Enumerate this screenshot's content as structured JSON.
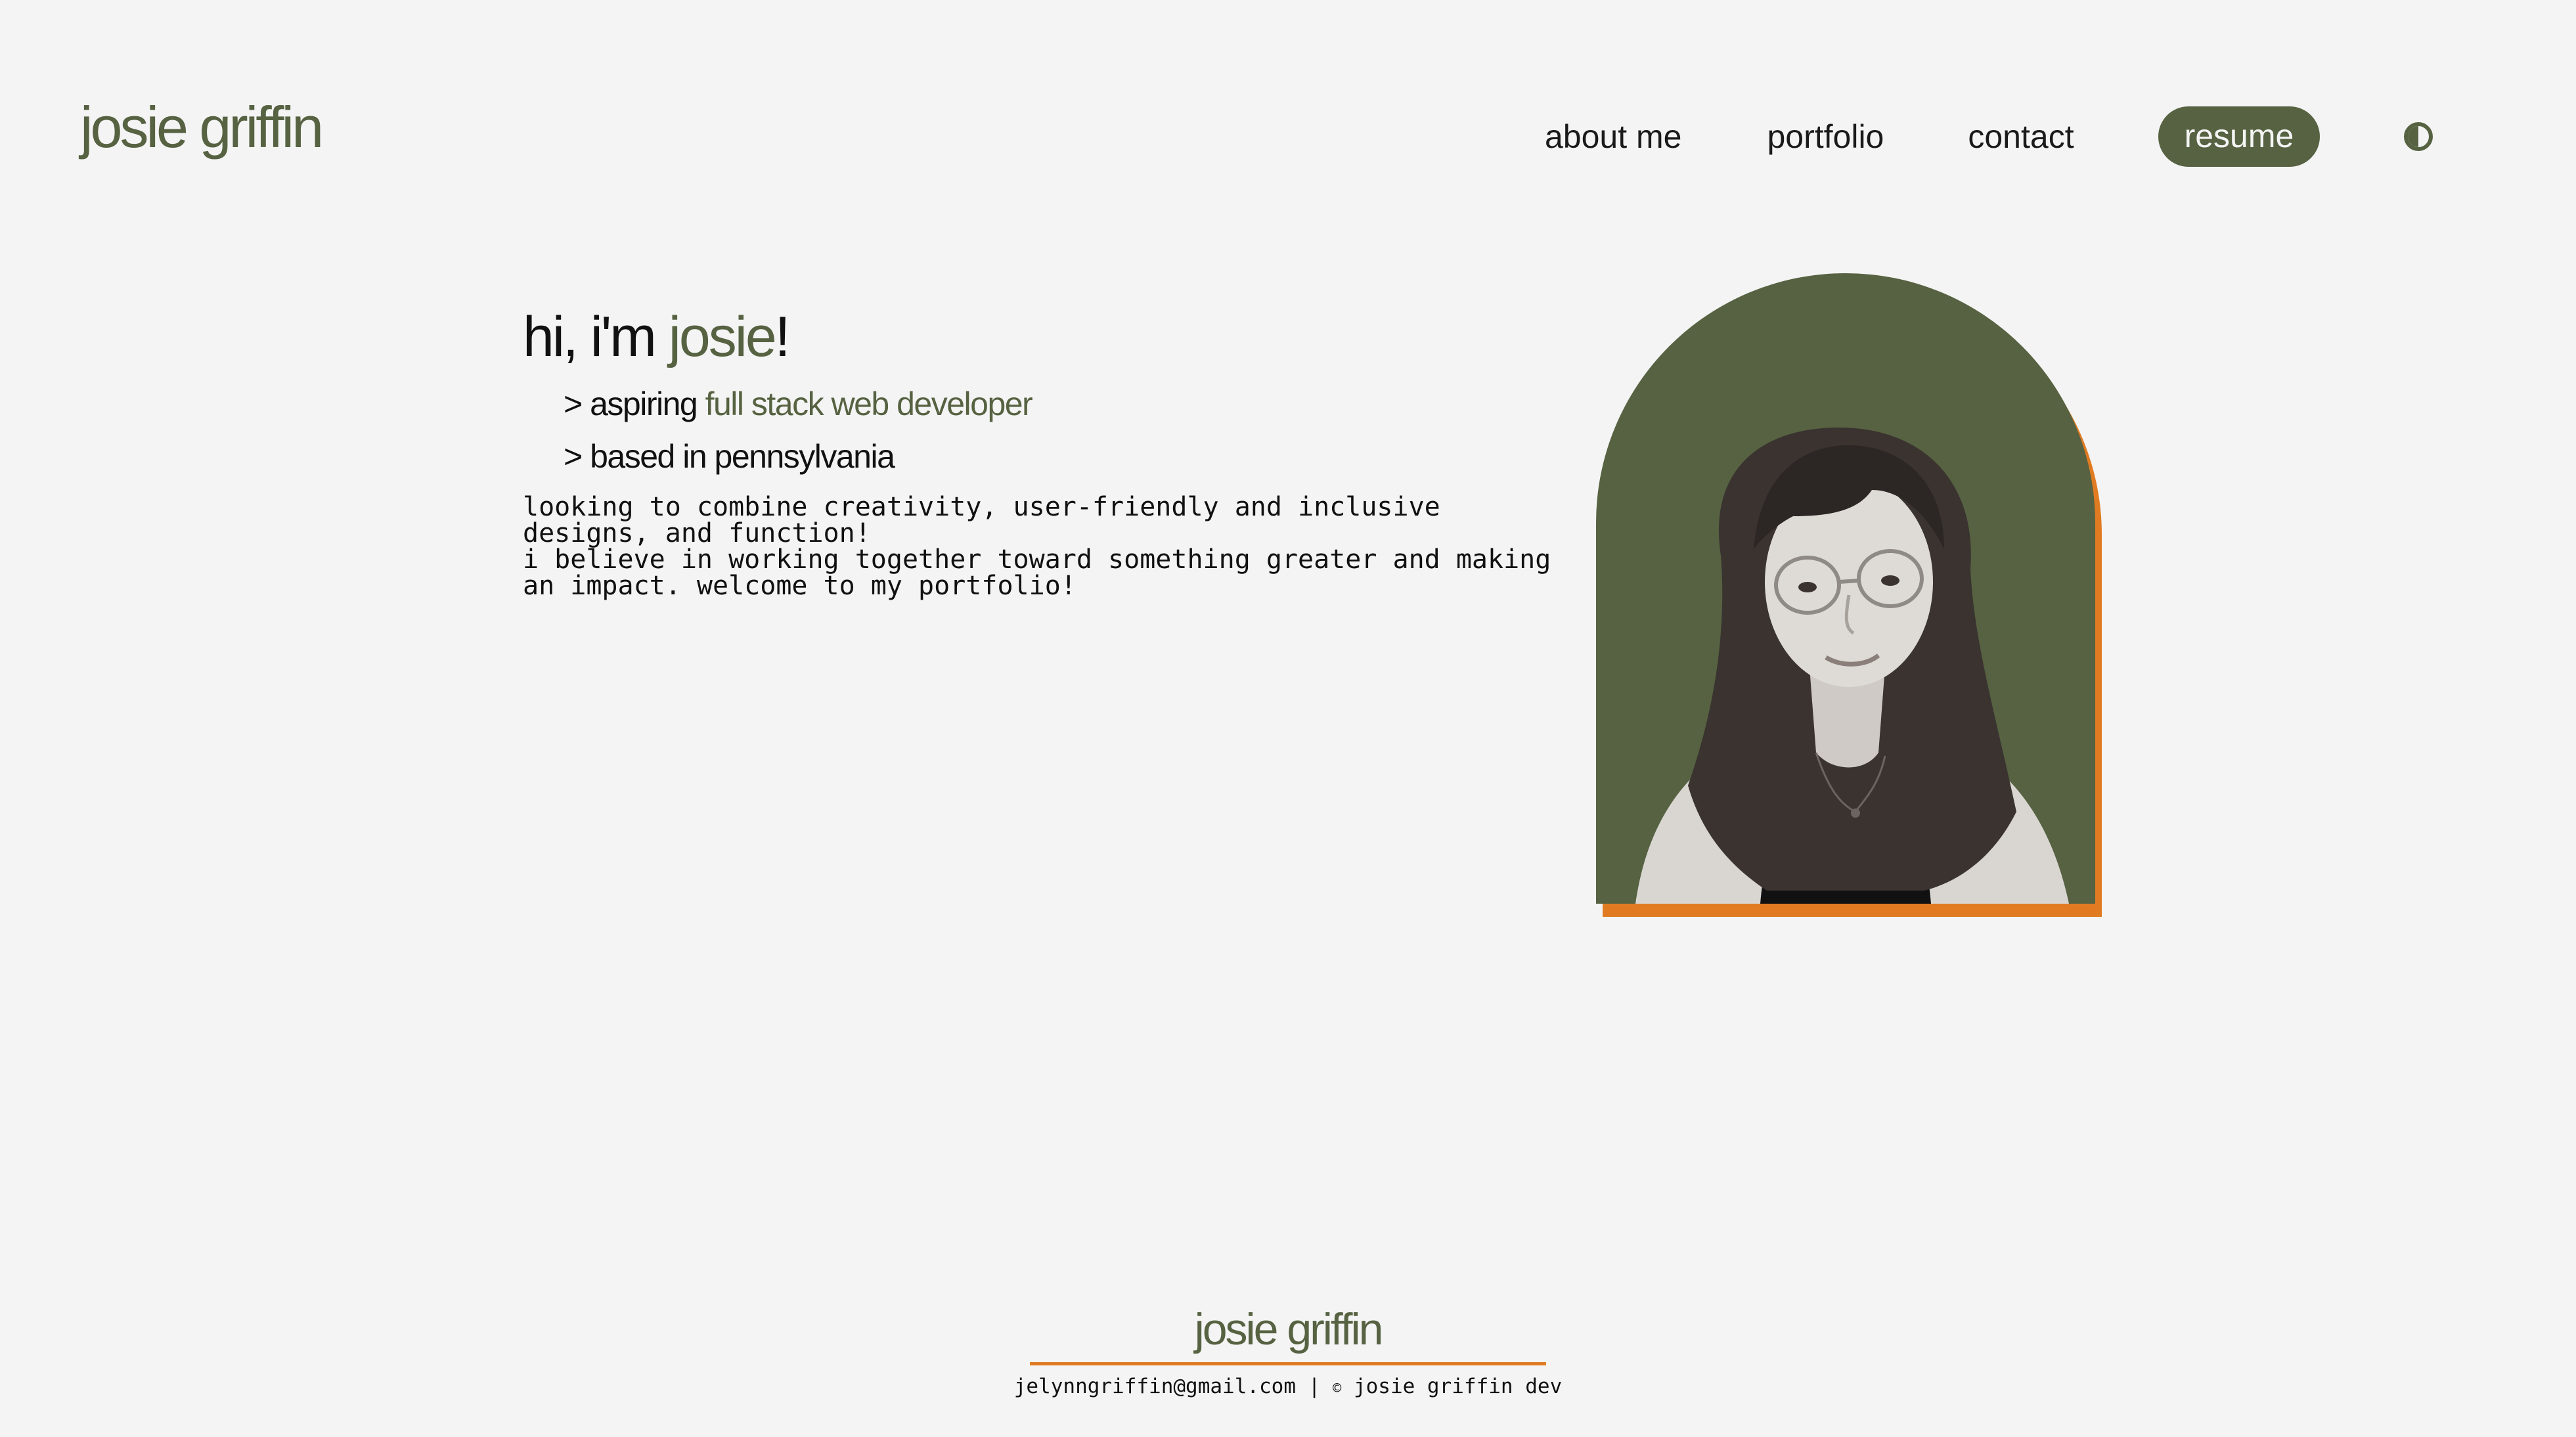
{
  "header": {
    "logo": "josie griffin",
    "nav": {
      "about": "about me",
      "portfolio": "portfolio",
      "contact": "contact",
      "resume": "resume"
    },
    "theme_toggle_icon": "contrast-icon"
  },
  "hero": {
    "greeting_prefix": "hi, i'm ",
    "greeting_name": "josie",
    "greeting_suffix": "!",
    "line1_prefix": "> aspiring ",
    "line1_accent": "full stack web developer",
    "line2": "> based in pennsylvania",
    "description_1": "looking to combine creativity, user-friendly and inclusive designs, and function!",
    "description_2": "i believe in working together toward something greater and making an impact. welcome to my portfolio!"
  },
  "portrait": {
    "alt": "portrait photo"
  },
  "footer": {
    "logo": "josie griffin",
    "email": "jelynngriffin@gmail.com",
    "separator": "|",
    "copyright_symbol": "©",
    "credit": "josie griffin dev"
  },
  "colors": {
    "background": "#f4f4f4",
    "accent_green": "#566241",
    "accent_orange": "#e07b22",
    "text": "#111111"
  }
}
